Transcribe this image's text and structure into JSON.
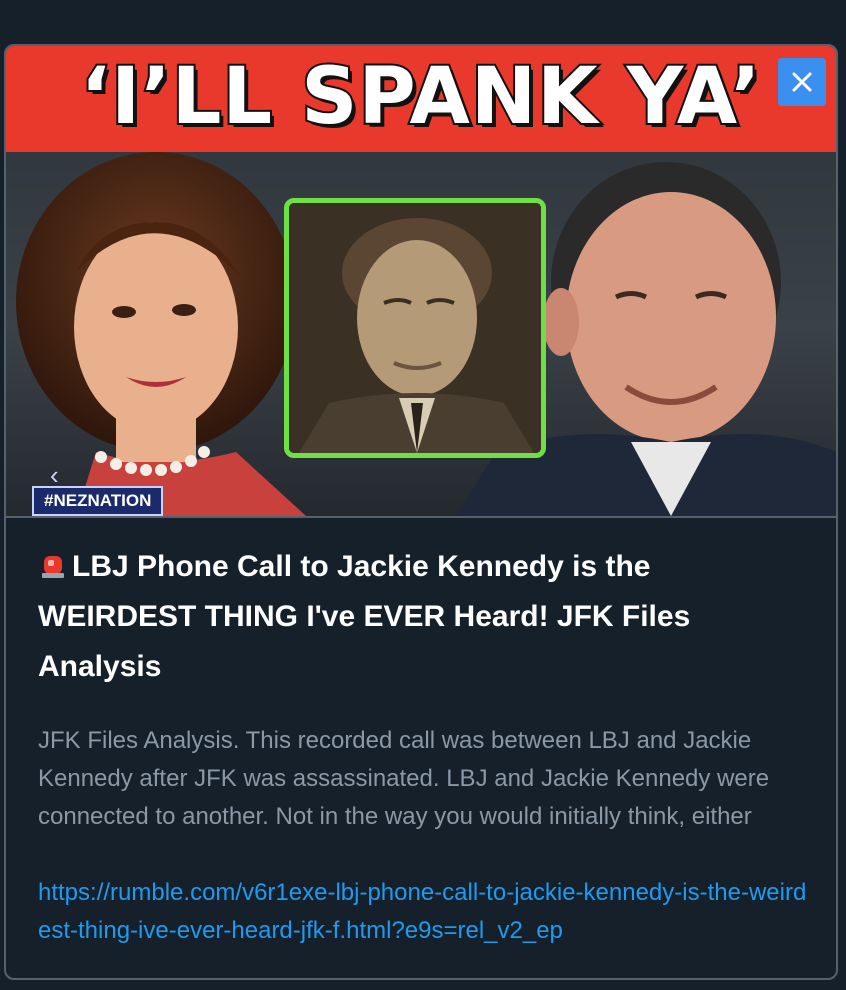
{
  "card": {
    "banner_text": "‘I’LL SPANK YA’",
    "hashtag": "#NEZNATION",
    "title": "LBJ Phone Call to Jackie Kennedy is the WEIRDEST THING I've EVER Heard! JFK Files Analysis",
    "description": "JFK Files Analysis. This recorded call was between LBJ and Jackie Kennedy after JFK was assassinated. LBJ and Jackie Kennedy were connected to another. Not in the way you would initially think, either",
    "url": "https://rumble.com/v6r1exe-lbj-phone-call-to-jackie-kennedy-is-the-weirdest-thing-ive-ever-heard-jfk-f.html?e9s=rel_v2_ep",
    "close_icon": "close-icon",
    "title_icon": "rotating-light-icon"
  },
  "colors": {
    "background": "#15202b",
    "banner": "#e8392c",
    "close_button": "#3b8ff0",
    "frame_highlight": "#6fe044",
    "link": "#1d9bf0",
    "muted_text": "#8b98a5"
  }
}
